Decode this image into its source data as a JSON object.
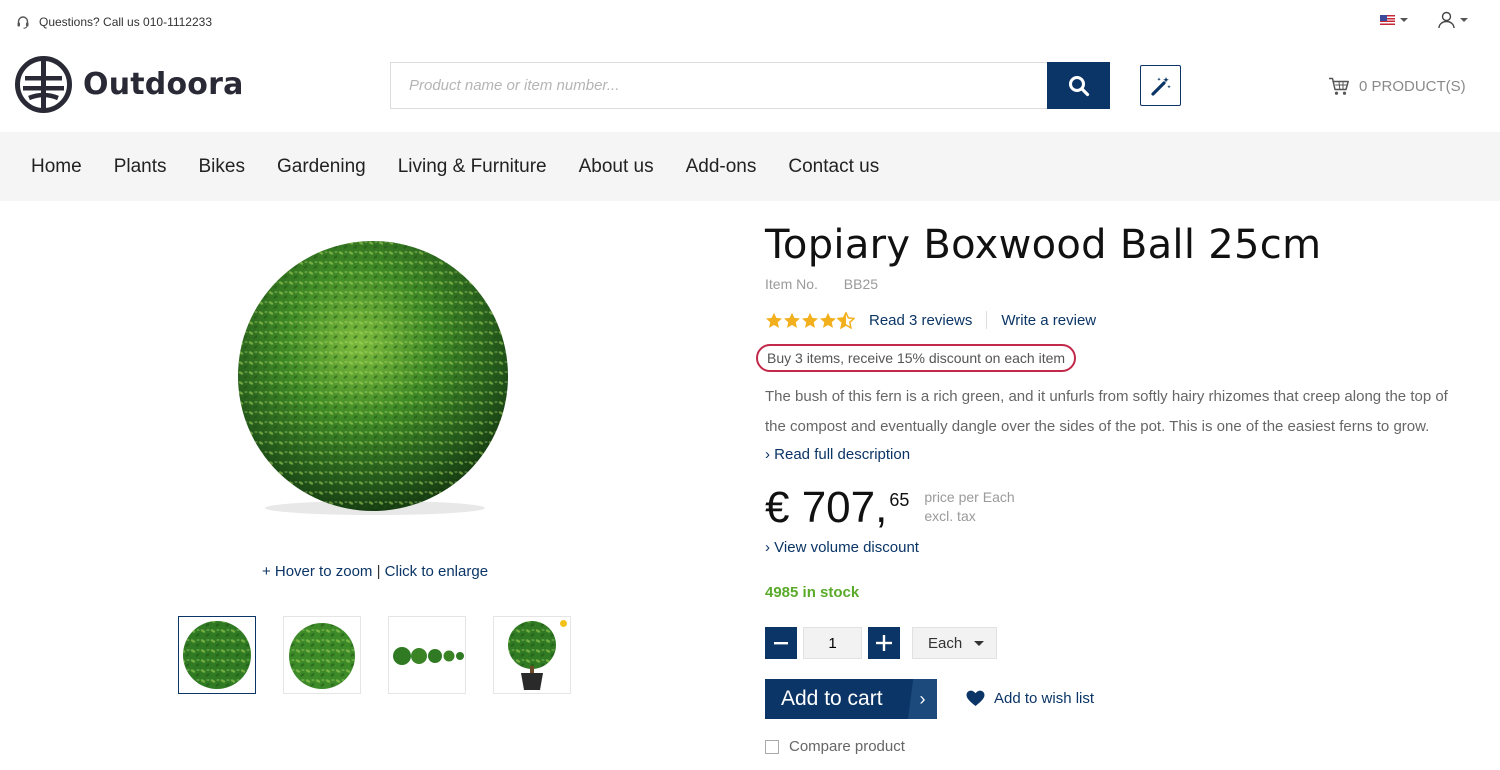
{
  "topbar": {
    "questions_text": "Questions? Call us 010-1112233",
    "headset_icon": "headset-icon",
    "flag_icon": "us-flag-icon",
    "user_icon": "user-icon"
  },
  "header": {
    "brand": "Outdoora",
    "search_placeholder": "Product name or item number...",
    "search_icon": "search-icon",
    "magic_icon": "magic-wand-icon",
    "cart_label": "0 PRODUCT(S)"
  },
  "nav": {
    "items": [
      "Home",
      "Plants",
      "Bikes",
      "Gardening",
      "Living & Furniture",
      "About us",
      "Add-ons",
      "Contact us"
    ]
  },
  "gallery": {
    "hover_text": "+ Hover to zoom",
    "separator": "|",
    "click_text": "Click to enlarge",
    "thumbnail_count": 4
  },
  "product": {
    "title": "Topiary Boxwood Ball 25cm",
    "item_no_label": "Item No.",
    "item_no_value": "BB25",
    "rating": 4.5,
    "reviews_link": "Read 3 reviews",
    "write_review": "Write a review",
    "promo": "Buy 3 items, receive 15% discount on each item",
    "description": "The bush of this fern is a rich green, and it unfurls from softly hairy rhizomes that creep along the top of the compost and eventually dangle over the sides of the pot. This is one of the easiest ferns to grow.",
    "read_full": "› Read full description",
    "price_main": "€ 707,",
    "price_cents": "65",
    "price_per": "price per Each",
    "price_tax": "excl. tax",
    "volume_discount": "› View volume discount",
    "stock": "4985 in stock",
    "quantity": "1",
    "unit": "Each",
    "add_to_cart": "Add to cart",
    "add_to_cart_arrow": "›",
    "wish_list": "Add to wish list",
    "compare": "Compare product"
  },
  "colors": {
    "primary": "#0b3566",
    "promo_border": "#c2294a",
    "stock": "#5aaa2a",
    "star": "#f2b01e"
  }
}
